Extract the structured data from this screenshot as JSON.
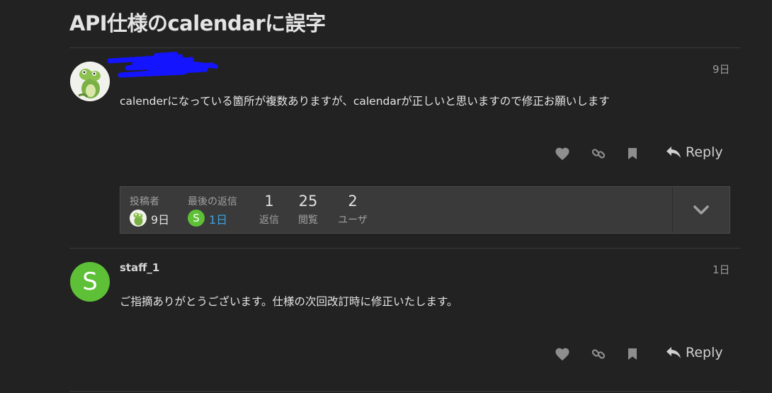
{
  "topic": {
    "title": "API仕様のcalendarに誤字"
  },
  "posts": [
    {
      "author": "",
      "date": "9日",
      "body": "calenderになっている箇所が複数ありますが、calendarが正しいと思いますので修正お願いします",
      "reply_label": "Reply"
    },
    {
      "author": "staff_1",
      "avatar_letter": "S",
      "date": "1日",
      "body": "ご指摘ありがとうございます。仕様の次回改訂時に修正いたします。",
      "reply_label": "Reply"
    }
  ],
  "topic_map": {
    "created_label": "投稿者",
    "created_age": "9日",
    "last_reply_label": "最後の返信",
    "last_reply_age": "1日",
    "last_reply_avatar_letter": "S",
    "replies": "1",
    "replies_label": "返信",
    "views": "25",
    "views_label": "閲覧",
    "users": "2",
    "users_label": "ユーザ"
  },
  "colors": {
    "background": "#222222",
    "accent_link": "#3ba1e0",
    "staff_avatar": "#5dc036",
    "redaction": "#1414ff"
  },
  "icons": [
    "heart-icon",
    "link-icon",
    "bookmark-icon",
    "reply-icon",
    "chevron-down-icon"
  ]
}
